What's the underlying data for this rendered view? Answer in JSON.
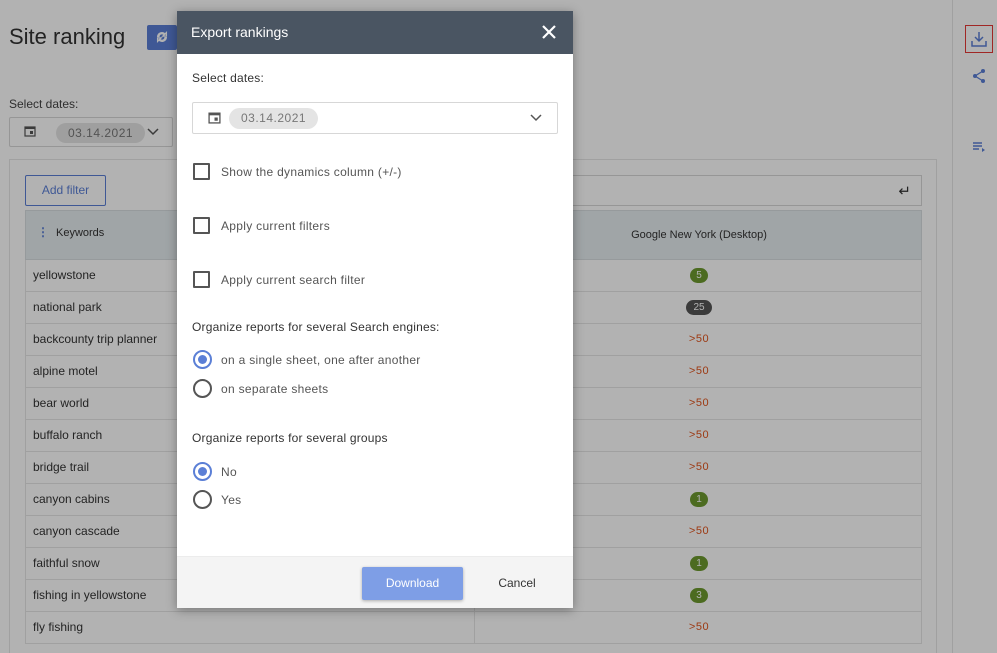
{
  "page": {
    "title": "Site ranking",
    "dates_label": "Select dates:",
    "date_chip": "03.14.2021",
    "add_filter_label": "Add filter"
  },
  "table": {
    "keywords_header": "Keywords",
    "engine_header": "Google New York (Desktop)",
    "rows": [
      {
        "keyword": "yellowstone",
        "position": "5",
        "style": "green"
      },
      {
        "keyword": "national park",
        "position": "25",
        "style": "dark"
      },
      {
        "keyword": "backcounty trip planner",
        "position": ">50",
        "style": "red"
      },
      {
        "keyword": "alpine motel",
        "position": ">50",
        "style": "red"
      },
      {
        "keyword": "bear world",
        "position": ">50",
        "style": "red"
      },
      {
        "keyword": "buffalo ranch",
        "position": ">50",
        "style": "red"
      },
      {
        "keyword": "bridge trail",
        "position": ">50",
        "style": "red"
      },
      {
        "keyword": "canyon cabins",
        "position": "1",
        "style": "green"
      },
      {
        "keyword": "canyon cascade",
        "position": ">50",
        "style": "red"
      },
      {
        "keyword": "faithful snow",
        "position": "1",
        "style": "green"
      },
      {
        "keyword": "fishing in yellowstone",
        "position": "3",
        "style": "green"
      },
      {
        "keyword": "fly fishing",
        "position": ">50",
        "style": "red"
      }
    ]
  },
  "modal": {
    "title": "Export rankings",
    "select_dates_label": "Select dates:",
    "date_chip": "03.14.2021",
    "checkboxes": {
      "dynamics": "Show the dynamics column (+/-)",
      "filters": "Apply current filters",
      "search_filter": "Apply current search filter"
    },
    "engines_section": {
      "label": "Organize reports for several Search engines:",
      "option_single": "on a single sheet, one after another",
      "option_separate": "on separate sheets",
      "selected": "single"
    },
    "groups_section": {
      "label": "Organize reports for several groups",
      "option_no": "No",
      "option_yes": "Yes",
      "selected": "No"
    },
    "download_label": "Download",
    "cancel_label": "Cancel"
  },
  "colors": {
    "accent": "#5b7fd6",
    "header_bg": "#4a5562",
    "badge_green": "#6d9a2f",
    "position_red": "#e0531c"
  }
}
